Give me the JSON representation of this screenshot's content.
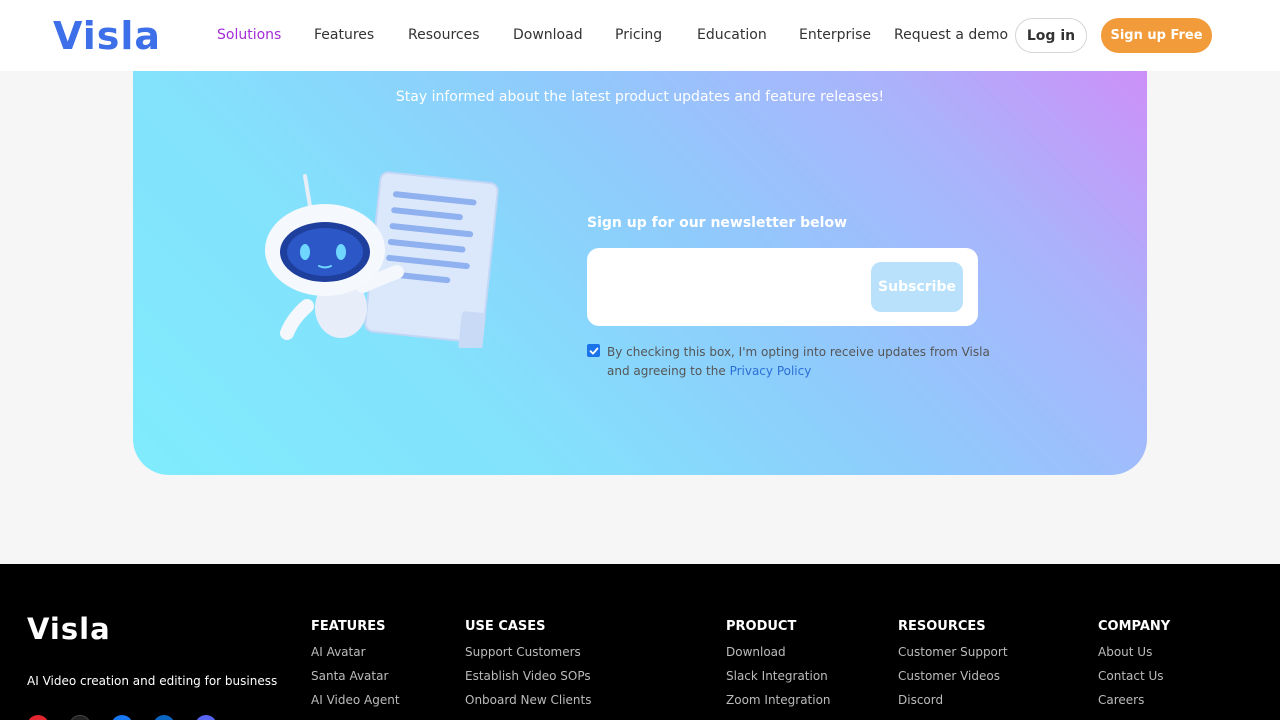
{
  "header": {
    "logo": "Visla",
    "nav": [
      "Solutions",
      "Features",
      "Resources",
      "Download",
      "Pricing",
      "Education",
      "Enterprise",
      "Request a demo"
    ],
    "login_label": "Log in",
    "signup_label": "Sign up Free",
    "active_color": "#a32bd6",
    "accent_color": "#f19b3b"
  },
  "newsletter": {
    "tagline": "Stay informed about the latest product updates and feature releases!",
    "heading": "Sign up for our newsletter below",
    "email_value": "",
    "subscribe_label": "Subscribe",
    "consent_checked": true,
    "consent_text": "By checking this box, I'm opting into receive updates from Visla and agreeing to the",
    "privacy_link": "Privacy Policy"
  },
  "footer": {
    "logo": "Visla",
    "tagline": "AI Video creation and editing for business",
    "columns": [
      {
        "title": "FEATURES",
        "links": [
          "AI Avatar",
          "Santa Avatar",
          "AI Video Agent"
        ]
      },
      {
        "title": "USE CASES",
        "links": [
          "Support Customers",
          "Establish Video SOPs",
          "Onboard New Clients"
        ]
      },
      {
        "title": "PRODUCT",
        "links": [
          "Download",
          "Slack Integration",
          "Zoom Integration"
        ]
      },
      {
        "title": "RESOURCES",
        "links": [
          "Customer Support",
          "Customer Videos",
          "Discord"
        ]
      },
      {
        "title": "COMPANY",
        "links": [
          "About Us",
          "Contact Us",
          "Careers"
        ]
      }
    ],
    "social_icons": [
      "youtube-icon",
      "tiktok-icon",
      "facebook-icon",
      "linkedin-icon",
      "discord-icon"
    ]
  }
}
